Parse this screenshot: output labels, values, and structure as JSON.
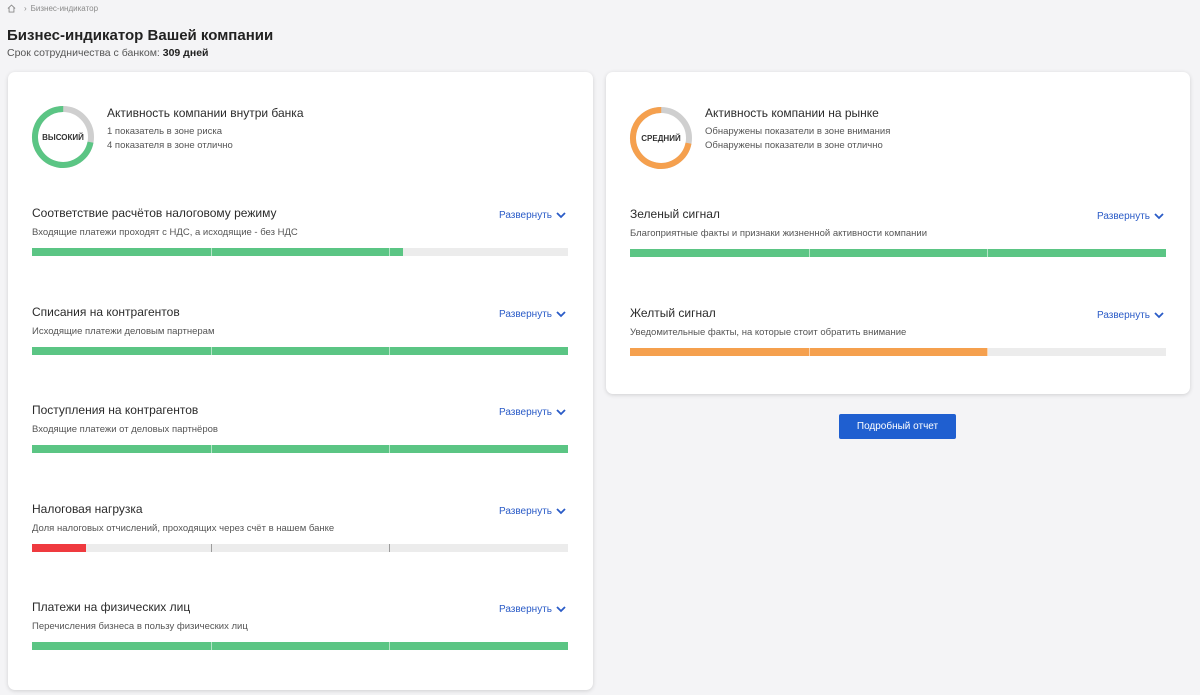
{
  "breadcrumb": {
    "current": "Бизнес-индикатор"
  },
  "header": {
    "title": "Бизнес-индикатор Вашей компании",
    "tenure_label": "Срок сотрудничества с банком:",
    "tenure_value": "309 дней"
  },
  "colors": {
    "green": "#5bc584",
    "orange": "#f5a04e",
    "red": "#ef3a3f",
    "track": "#ececec",
    "link": "#2a5bc7",
    "button": "#1f5fd0"
  },
  "bank_activity": {
    "gauge_label": "ВЫСОКИЙ",
    "gauge_fraction": 0.72,
    "gauge_color": "#5bc584",
    "title": "Активность компании внутри банка",
    "lines": [
      "1 показатель в зоне риска",
      "4 показателя в зоне отлично"
    ]
  },
  "bank_metrics": [
    {
      "title": "Соответствие расчётов налоговому режиму",
      "desc": "Входящие платежи проходят с НДС, а исходящие - без НДС",
      "expand": "Развернуть",
      "level": 0.693,
      "color": "#5bc584"
    },
    {
      "title": "Списания на контрагентов",
      "desc": "Исходящие платежи деловым партнерам",
      "expand": "Развернуть",
      "level": 1.0,
      "color": "#5bc584"
    },
    {
      "title": "Поступления на контрагентов",
      "desc": "Входящие платежи от деловых партнёров",
      "expand": "Развернуть",
      "level": 1.0,
      "color": "#5bc584"
    },
    {
      "title": "Налоговая нагрузка",
      "desc": "Доля налоговых отчислений, проходящих через счёт в нашем банке",
      "expand": "Развернуть",
      "level": 0.1,
      "color": "#ef3a3f"
    },
    {
      "title": "Платежи на физических лиц",
      "desc": "Перечисления бизнеса в пользу физических лиц",
      "expand": "Развернуть",
      "level": 1.0,
      "color": "#5bc584"
    }
  ],
  "market_activity": {
    "gauge_label": "СРЕДНИЙ",
    "gauge_fraction": 0.72,
    "gauge_color": "#f5a04e",
    "title": "Активность компании на рынке",
    "lines": [
      "Обнаружены показатели в зоне внимания",
      "Обнаружены показатели в зоне отлично"
    ]
  },
  "market_metrics": [
    {
      "title": "Зеленый сигнал",
      "desc": "Благоприятные факты и признаки жизненной активности компании",
      "expand": "Развернуть",
      "level": 1.0,
      "color": "#5bc584"
    },
    {
      "title": "Желтый сигнал",
      "desc": "Уведомительные факты, на которые стоит обратить внимание",
      "expand": "Развернуть",
      "level": 0.667,
      "color": "#f5a04e"
    }
  ],
  "report_button": "Подробный отчет"
}
